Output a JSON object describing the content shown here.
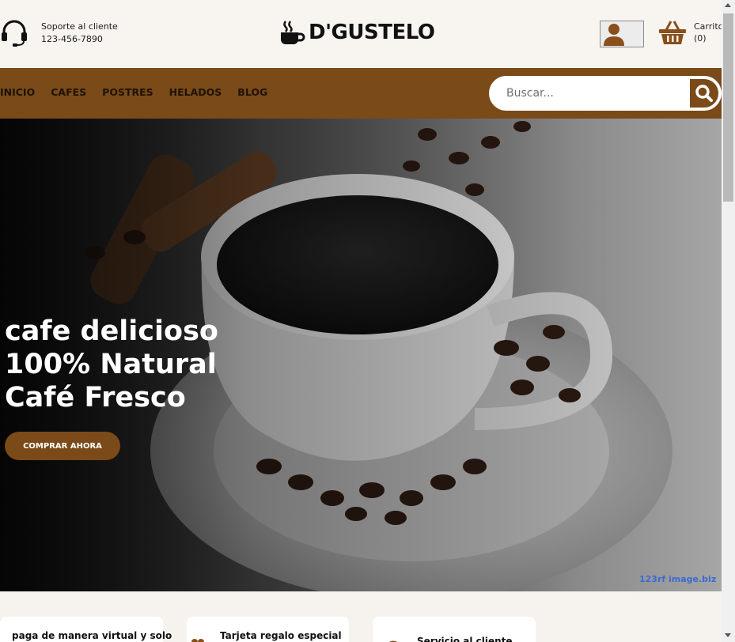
{
  "header": {
    "support_label": "Soporte al cliente",
    "support_phone": "123-456-7890",
    "brand_name": "D'GUSTELO",
    "cart_label": "Carrito",
    "cart_count": "(0)"
  },
  "nav": {
    "items": [
      {
        "label": "INICIO"
      },
      {
        "label": "CAFES"
      },
      {
        "label": "POSTRES"
      },
      {
        "label": "HELADOS"
      },
      {
        "label": "BLOG"
      }
    ],
    "search_placeholder": "Buscar..."
  },
  "hero": {
    "line1": "cafe delicioso",
    "line2": "100% Natural",
    "line3": "Café Fresco",
    "button_label": "COMPRAR AHORA",
    "watermark": "123rf image.biz"
  },
  "features": [
    {
      "label": "paga de manera virtual y solo"
    },
    {
      "label": "Tarjeta regalo especial"
    },
    {
      "label": "Servicio al cliente"
    }
  ],
  "colors": {
    "brand_brown": "#7a4a19",
    "header_bg": "#f8f5f1"
  }
}
